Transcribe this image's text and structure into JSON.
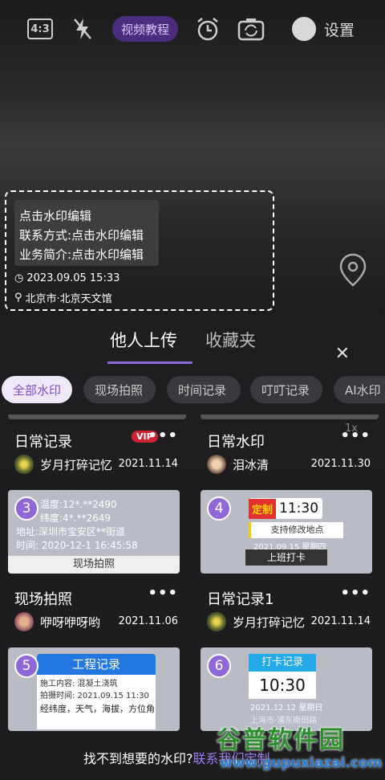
{
  "topbar": {
    "ratio": "4:3",
    "tutorial": "视频教程",
    "settings": "设置",
    "icons": [
      "flash-off-icon",
      "alarm-icon",
      "camera-switch-icon"
    ]
  },
  "watermark": {
    "lines": [
      "点击水印编辑",
      "联系方式:点击水印编辑",
      "业务简介:点击水印编辑"
    ],
    "date": "2023.09.05 15:33",
    "location": "北京市·北京天文馆"
  },
  "sheet": {
    "tabs": [
      "他人上传",
      "收藏夹"
    ],
    "chips": [
      "全部水印",
      "现场拍照",
      "时间记录",
      "叮叮记录",
      "AI水印"
    ],
    "active_chip": 0,
    "cards": [
      {
        "title": "日常记录",
        "vip": "VIP",
        "user": "岁月打碎记忆",
        "date": "2021.11.14",
        "num": "3",
        "thumb": [
          "温度:12*.**2490",
          "纬度:4*.**2649",
          "地址:深圳市宝安区**街道",
          "时间: 2020-12-1 16:45:58",
          "现场拍照"
        ]
      },
      {
        "title": "日常水印",
        "user": "泪冰清",
        "date": "2021.11.30",
        "num": "4",
        "thumb": [
          "定制",
          "11:30",
          "支持修改地点",
          "2021.09.15 星期四",
          "上班打卡"
        ]
      },
      {
        "title": "现场拍照",
        "user": "咿呀咿呀哟",
        "date": "2021.11.06",
        "num": "5",
        "thumb": [
          "工程记录",
          "施工内容: 混凝土浇筑",
          "拍摄时间: 2021.09.15 11:30",
          "经纬度，天气，海拔，方位角"
        ]
      },
      {
        "title": "日常记录1",
        "user": "岁月打碎记忆",
        "date": "2021.11.14",
        "num": "6",
        "thumb": [
          "打卡记录",
          "10:30",
          "2021.12.12 星期日",
          "上海市·浦东南田路"
        ]
      }
    ],
    "bottom_text": "找不到想要的水印?",
    "bottom_link": "联系我们定制",
    "zoom": "1x"
  },
  "logo": {
    "cn": "谷普软件园",
    "url": "www.gupuxiazai.com"
  },
  "colors": {
    "accent": "#8e6bd8",
    "tutorial_bg": "#4a2d7d",
    "badge": "#8f68d8"
  }
}
